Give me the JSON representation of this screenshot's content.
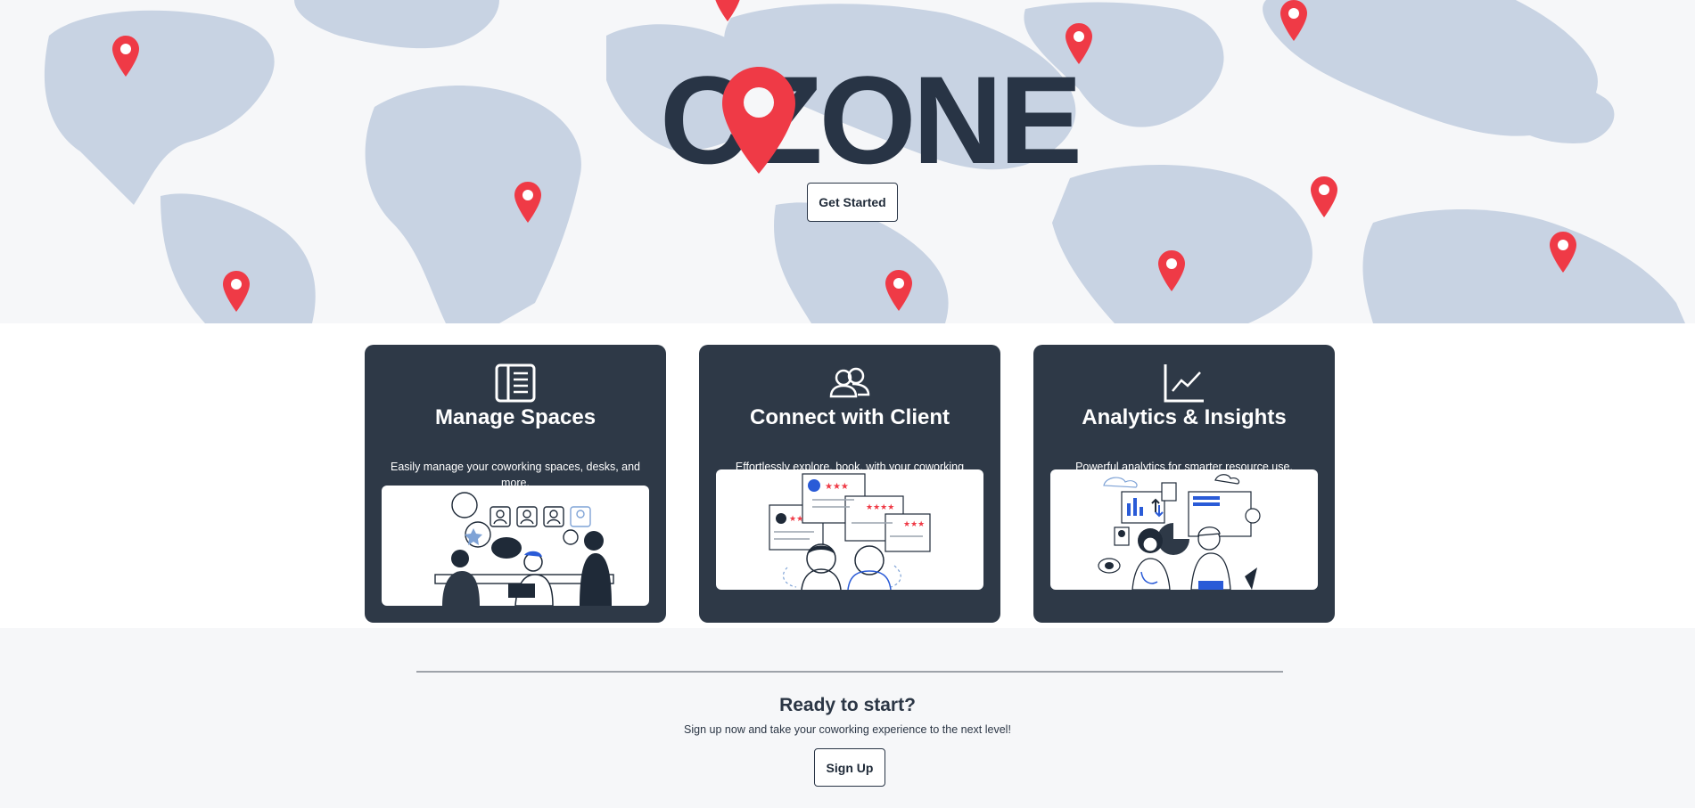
{
  "brand": {
    "logo_text": "CZONE",
    "pin_color": "#ef3a46",
    "dark_color": "#283445"
  },
  "hero": {
    "cta_label": "Get Started",
    "map_color": "#c8d3e3"
  },
  "features": [
    {
      "title": "Manage Spaces",
      "description": "Easily manage your coworking spaces, desks, and more.",
      "icon": "book-icon"
    },
    {
      "title": "Connect with Client",
      "description": "Effortlessly explore, book, with your coworking space.",
      "icon": "users-icon"
    },
    {
      "title": "Analytics & Insights",
      "description": "Powerful analytics for smarter resource use.",
      "icon": "line-chart-icon"
    }
  ],
  "cta": {
    "heading": "Ready to start?",
    "text": "Sign up now and take your coworking experience to the next level!",
    "button_label": "Sign Up"
  }
}
